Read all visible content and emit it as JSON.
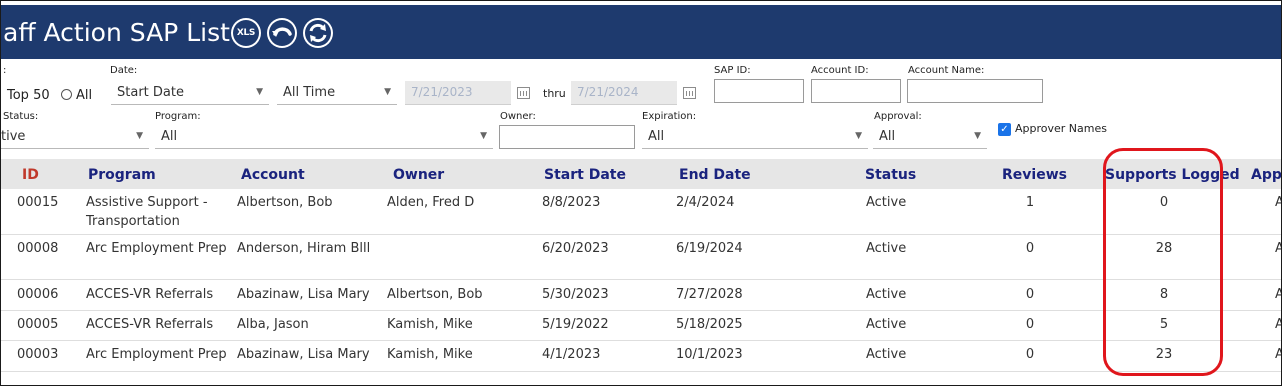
{
  "title": "aff Action SAP List",
  "toolbar": {
    "xls_label": "XLS"
  },
  "filters": {
    "top_label": ":",
    "top50_label": "Top 50",
    "all_label": "All",
    "date_label": "Date:",
    "date_field": "Start Date",
    "date_range": "All Time",
    "date_from": "7/21/2023",
    "thru_label": "thru",
    "date_to": "7/21/2024",
    "sap_id_label": "SAP ID:",
    "account_id_label": "Account ID:",
    "account_name_label": "Account Name:",
    "status_label": "Status:",
    "status_value": "tive",
    "program_label": "Program:",
    "program_value": "All",
    "owner_label": "Owner:",
    "expiration_label": "Expiration:",
    "expiration_value": "All",
    "approval_label": "Approval:",
    "approval_value": "All",
    "approver_names_label": "Approver Names"
  },
  "columns": [
    "ID",
    "Program",
    "Account",
    "Owner",
    "Start Date",
    "End Date",
    "Status",
    "Reviews",
    "Supports Logged",
    "App"
  ],
  "rows": [
    {
      "id": "00015",
      "program": "Assistive Support - Transportation",
      "account": "Albertson, Bob",
      "owner": "Alden, Fred D",
      "start": "8/8/2023",
      "end": "2/4/2024",
      "status": "Active",
      "reviews": "1",
      "supports": "0",
      "app": "A"
    },
    {
      "id": "00008",
      "program": "Arc Employment Prep",
      "account": "Anderson, Hiram Blll",
      "owner": "",
      "start": "6/20/2023",
      "end": "6/19/2024",
      "status": "Active",
      "reviews": "0",
      "supports": "28",
      "app": "A"
    },
    {
      "id": "00006",
      "program": "ACCES-VR Referrals",
      "account": "Abazinaw, Lisa Mary",
      "owner": "Albertson, Bob",
      "start": "5/30/2023",
      "end": "7/27/2028",
      "status": "Active",
      "reviews": "0",
      "supports": "8",
      "app": "A"
    },
    {
      "id": "00005",
      "program": "ACCES-VR Referrals",
      "account": "Alba, Jason",
      "owner": "Kamish, Mike",
      "start": "5/19/2022",
      "end": "5/18/2025",
      "status": "Active",
      "reviews": "0",
      "supports": "5",
      "app": "A"
    },
    {
      "id": "00003",
      "program": "Arc Employment Prep",
      "account": "Abazinaw, Lisa Mary",
      "owner": "Kamish, Mike",
      "start": "4/1/2023",
      "end": "10/1/2023",
      "status": "Active",
      "reviews": "0",
      "supports": "23",
      "app": "A"
    }
  ]
}
